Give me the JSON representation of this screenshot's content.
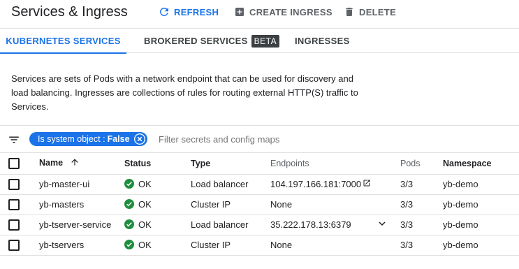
{
  "header": {
    "title": "Services & Ingress",
    "refresh_label": "REFRESH",
    "create_label": "CREATE INGRESS",
    "delete_label": "DELETE"
  },
  "tabs": [
    {
      "label": "KUBERNETES SERVICES",
      "active": true
    },
    {
      "label": "BROKERED SERVICES",
      "badge": "BETA",
      "active": false
    },
    {
      "label": "INGRESSES",
      "active": false
    }
  ],
  "description": {
    "line1": "Services are sets of Pods with a network endpoint that can be used for discovery and",
    "line2": "load balancing. Ingresses are collections of rules for routing external HTTP(S) traffic to",
    "line3": "Services."
  },
  "filter": {
    "chip_key": "Is system object :",
    "chip_value": "False",
    "placeholder": "Filter secrets and config maps"
  },
  "table": {
    "columns": {
      "name": "Name",
      "status": "Status",
      "type": "Type",
      "endpoints": "Endpoints",
      "pods": "Pods",
      "namespace": "Namespace"
    },
    "rows": [
      {
        "name": "yb-master-ui",
        "status": "OK",
        "type": "Load balancer",
        "endpoints": "104.197.166.181:7000",
        "pods": "3/3",
        "namespace": "yb-demo"
      },
      {
        "name": "yb-masters",
        "status": "OK",
        "type": "Cluster IP",
        "endpoints": "None",
        "pods": "3/3",
        "namespace": "yb-demo"
      },
      {
        "name": "yb-tserver-service",
        "status": "OK",
        "type": "Load balancer",
        "endpoints": "35.222.178.13:6379",
        "pods": "3/3",
        "namespace": "yb-demo"
      },
      {
        "name": "yb-tservers",
        "status": "OK",
        "type": "Cluster IP",
        "endpoints": "None",
        "pods": "3/3",
        "namespace": "yb-demo"
      }
    ]
  },
  "colors": {
    "accent": "#1a73e8",
    "ok_green": "#1e8e3e",
    "muted": "#5f6368"
  },
  "icons": [
    "refresh-icon",
    "add-box-icon",
    "trash-icon",
    "filter-list-icon",
    "close-circle-icon",
    "arrow-up-icon",
    "check-circle-icon",
    "external-link-icon",
    "chevron-down-icon"
  ]
}
